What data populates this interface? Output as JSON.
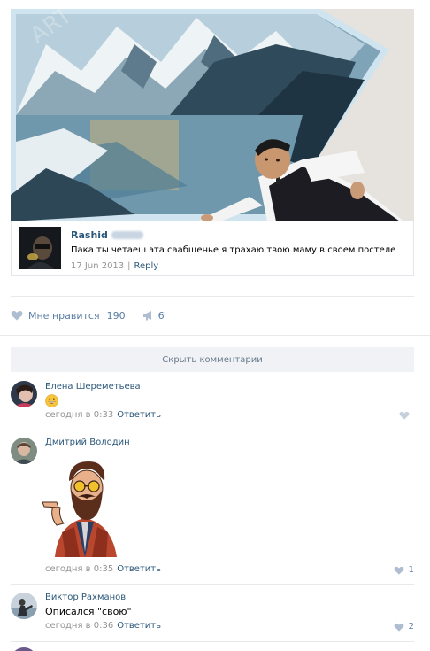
{
  "post": {
    "photo": {
      "description": "photo"
    },
    "embedded_comment": {
      "author": "Rashid",
      "text": "Пака ты четаеш эта саабщенье я трахаю твою маму в своем постеле",
      "date": "17 Jun 2013",
      "separator": "|",
      "reply_label": "Reply"
    },
    "likes": {
      "label": "Мне нравится",
      "count": "190",
      "shares": "6"
    },
    "hide_comments_label": "Скрыть комментарии"
  },
  "comments": [
    {
      "author": "Елена Шереметьева",
      "emoji": "grinning-face",
      "time": "сегодня в 0:33",
      "reply_label": "Ответить",
      "likes": ""
    },
    {
      "author": "Дмитрий Володин",
      "sticker": "bearded-hipster-pointing",
      "time": "сегодня в 0:35",
      "reply_label": "Ответить",
      "likes": "1"
    },
    {
      "author": "Виктор Рахманов",
      "text": "Описался \"свою\"",
      "time": "сегодня в 0:36",
      "reply_label": "Ответить",
      "likes": "2"
    }
  ],
  "colors": {
    "link": "#2b587a",
    "meta": "#939393",
    "like_icon": "#aebed0",
    "divider": "#e7e8ec",
    "hide_bar_bg": "#f0f2f5"
  }
}
